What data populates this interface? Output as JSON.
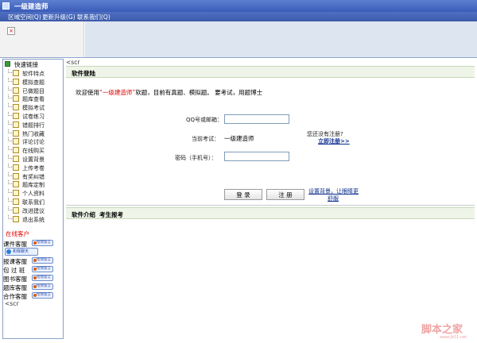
{
  "window": {
    "title": "一级建造师"
  },
  "menu": [
    "区域空间(Q)",
    "更新升级(G)",
    "联系我们(Q)"
  ],
  "header": {
    "broken_image_glyph": "×"
  },
  "sidebar": {
    "root_label": "快速链接",
    "items": [
      "软件特点",
      "模拟查题",
      "已做题目",
      "题库查看",
      "模拟考试",
      "试卷练习",
      "错题排行",
      "热门收藏",
      "评论讨论",
      "在线购买",
      "设置背景",
      "上传考卷",
      "有奖纠错",
      "题库定制",
      "个人资料",
      "联系我们",
      "改进建议",
      "退出系统"
    ],
    "online_title": "在线客户",
    "service_rows": [
      {
        "label": "课件客服",
        "badge": "给我留言"
      },
      {
        "label": "报课客服",
        "badge": "给我留言"
      },
      {
        "label": "包 过 班",
        "badge": "给我留言"
      },
      {
        "label": "图书客服",
        "badge": "给我留言"
      },
      {
        "label": "题库客服",
        "badge": "给我留言"
      },
      {
        "label": "合作客服",
        "badge": "给我留言"
      }
    ],
    "qq_chat_label": "和我聊天",
    "tail_text": "<scr"
  },
  "main": {
    "tail_text": "<scr",
    "section_title": "软件登陆",
    "welcome": {
      "prefix": "欢迎使用",
      "product": "“一级建造师”",
      "suffix": "软题，目前有真题、模拟题。 要考试，用题博士"
    },
    "form": {
      "qq_label": "QQ号或邮箱：",
      "qq_value": "",
      "exam_label": "当前考试：",
      "exam_value": "一级建造师",
      "password_label": "密码（手机号）：",
      "password_value": ""
    },
    "register_question": "您还没有注册?",
    "register_link": "立即注册>>",
    "buttons": {
      "login": "登 录",
      "register": "注 册"
    },
    "help_link_line1": "设置背景，让眼睛更",
    "help_link_line2": "舒服",
    "bottom_tabs": [
      "软件介绍",
      "考生报考"
    ]
  },
  "watermark": {
    "main": "脚本之家",
    "sub": "www.jb51.net"
  },
  "colors": {
    "title_bar": "#3b5cb8",
    "menu_bar": "#4f6fc4",
    "header_panel": "#dde5f1",
    "accent_red": "#e00000",
    "section_bg": "#eef5e8",
    "link_blue": "#0b2c8c"
  }
}
